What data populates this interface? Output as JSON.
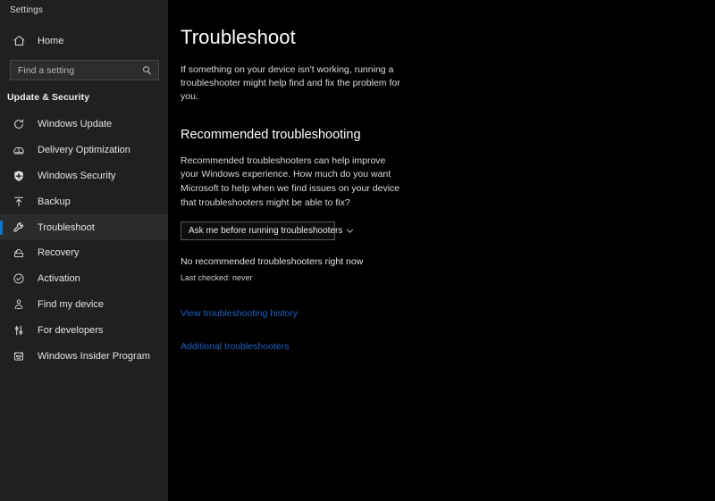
{
  "window": {
    "title": "Settings"
  },
  "sidebar": {
    "home": {
      "label": "Home",
      "icon": "home-icon"
    },
    "search": {
      "placeholder": "Find a setting",
      "value": "",
      "icon": "search-icon"
    },
    "group_label": "Update & Security",
    "items": [
      {
        "label": "Windows Update",
        "icon": "sync-refresh-icon",
        "selected": false
      },
      {
        "label": "Delivery Optimization",
        "icon": "delivery-truck-icon",
        "selected": false
      },
      {
        "label": "Windows Security",
        "icon": "shield-icon",
        "selected": false
      },
      {
        "label": "Backup",
        "icon": "backup-upload-icon",
        "selected": false
      },
      {
        "label": "Troubleshoot",
        "icon": "wrench-icon",
        "selected": true
      },
      {
        "label": "Recovery",
        "icon": "recovery-icon",
        "selected": false
      },
      {
        "label": "Activation",
        "icon": "check-circle-icon",
        "selected": false
      },
      {
        "label": "Find my device",
        "icon": "find-device-person-icon",
        "selected": false
      },
      {
        "label": "For developers",
        "icon": "developer-tools-icon",
        "selected": false
      },
      {
        "label": "Windows Insider Program",
        "icon": "insider-program-icon",
        "selected": false
      }
    ]
  },
  "main": {
    "page_title": "Troubleshoot",
    "page_description": "If something on your device isn't working, running a troubleshooter might help find and fix the problem for you.",
    "section_title": "Recommended troubleshooting",
    "section_description": "Recommended troubleshooters can help improve your Windows experience. How much do you want Microsoft to help when we find issues on your device that troubleshooters might be able to fix?",
    "dropdown": {
      "value": "Ask me before running troubleshooters",
      "icon": "chevron-down-icon",
      "options": [
        "Ask me before running troubleshooters"
      ]
    },
    "status_primary": "No recommended troubleshooters right now",
    "status_secondary": "Last checked: never",
    "links": [
      "View troubleshooting history",
      "Additional troubleshooters"
    ]
  },
  "colors": {
    "accent": "#0078d7",
    "link": "#1f62c4",
    "sidebar_bg": "#202020",
    "main_bg": "#000000"
  }
}
